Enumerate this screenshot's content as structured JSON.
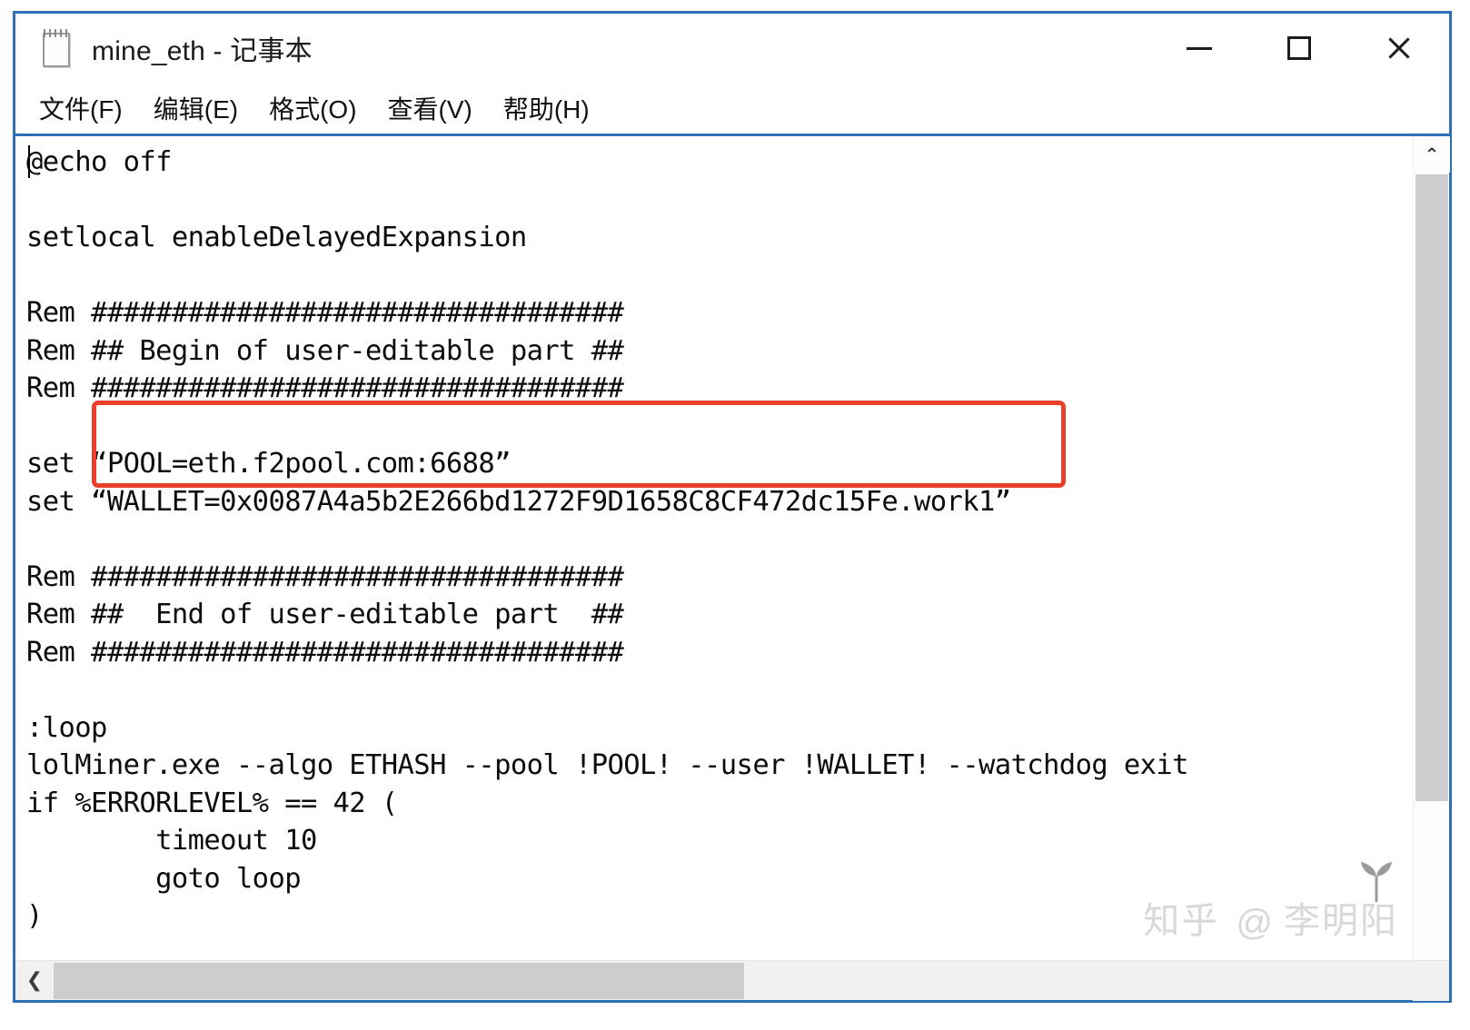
{
  "window": {
    "title": "mine_eth - 记事本",
    "icon": "notepad-icon",
    "minimize_label": "—",
    "maximize_label": "□",
    "close_label": "✕"
  },
  "menubar": {
    "items": [
      {
        "label": "文件(F)",
        "name": "menu-file"
      },
      {
        "label": "编辑(E)",
        "name": "menu-edit"
      },
      {
        "label": "格式(O)",
        "name": "menu-format"
      },
      {
        "label": "查看(V)",
        "name": "menu-view"
      },
      {
        "label": "帮助(H)",
        "name": "menu-help"
      }
    ]
  },
  "editor": {
    "content": "@echo off\n\nsetlocal enableDelayedExpansion\n\nRem #################################\nRem ## Begin of user-editable part ##\nRem #################################\n\nset “POOL=eth.f2pool.com:6688”\nset “WALLET=0x0087A4a5b2E266bd1272F9D1658C8CF472dc15Fe.work1”\n\nRem #################################\nRem ##  End of user-editable part  ##\nRem #################################\n\n:loop\nlolMiner.exe --algo ETHASH --pool !POOL! --user !WALLET! --watchdog exit\nif %ERRORLEVEL% == 42 (\n        timeout 10\n        goto loop\n)",
    "lines": [
      "@echo off",
      "",
      "setlocal enableDelayedExpansion",
      "",
      "Rem #################################",
      "Rem ## Begin of user-editable part ##",
      "Rem #################################",
      "",
      "set “POOL=eth.f2pool.com:6688”",
      "set “WALLET=0x0087A4a5b2E266bd1272F9D1658C8CF472dc15Fe.work1”",
      "",
      "Rem #################################",
      "Rem ##  End of user-editable part  ##",
      "Rem #################################",
      "",
      ":loop",
      "lolMiner.exe --algo ETHASH --pool !POOL! --user !WALLET! --watchdog exit",
      "if %ERRORLEVEL% == 42 (",
      "        timeout 10",
      "        goto loop",
      ")"
    ],
    "pool_value": "eth.f2pool.com:6688",
    "wallet_value": "0x0087A4a5b2E266bd1272F9D1658C8CF472dc15Fe.work1",
    "highlight_color": "#e8402a"
  },
  "scrollbars": {
    "vertical_up_arrow": "⌃",
    "horizontal_left_arrow": "❮"
  },
  "watermark": {
    "site": "知乎",
    "at": "@",
    "user": "李明阳"
  },
  "colors": {
    "window_border": "#2d70b8",
    "highlight": "#e8402a",
    "text": "#0c0c0c",
    "scroll_thumb": "#cdcdcd",
    "watermark": "#d8d8d8"
  }
}
